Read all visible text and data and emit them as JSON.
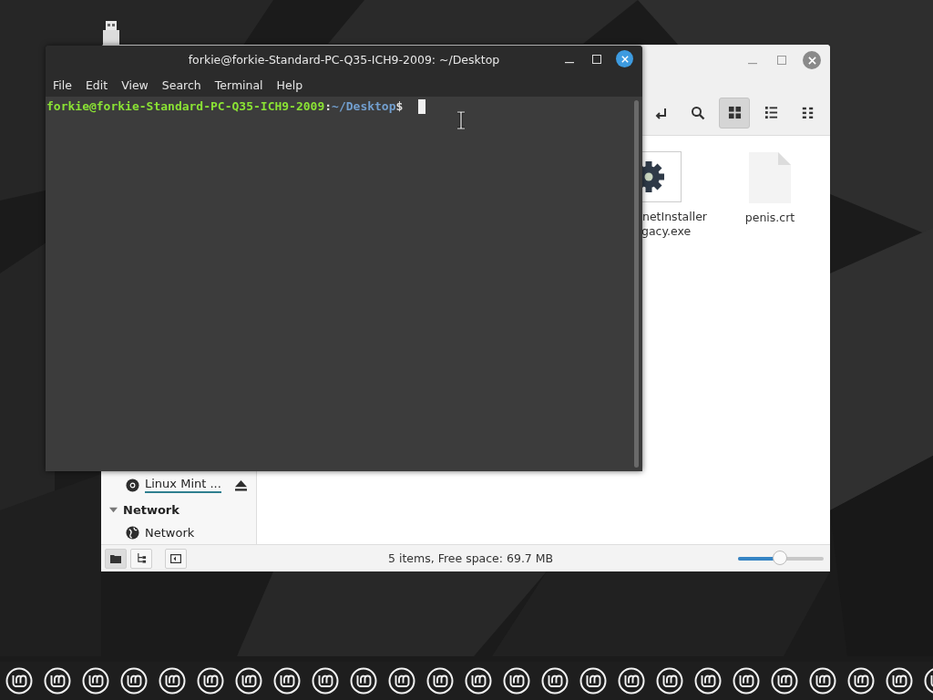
{
  "file_manager": {
    "toolbar": [
      {
        "kind": "location",
        "selected": false
      },
      {
        "kind": "search",
        "selected": false
      },
      {
        "kind": "icon_view",
        "selected": true
      },
      {
        "kind": "list_view",
        "selected": false
      },
      {
        "kind": "compact_view",
        "selected": false
      }
    ],
    "files": [
      {
        "kind": "executable",
        "name_lines": [
          "netInstaller",
          "gacy.exe"
        ]
      },
      {
        "kind": "document",
        "name_lines": [
          "penis.crt"
        ]
      }
    ],
    "sidebar": [
      {
        "kind": "device",
        "label": "Linux Mint ...",
        "level": 1,
        "ejectable": true
      },
      {
        "kind": "header",
        "label": "Network",
        "expanded": true
      },
      {
        "kind": "network",
        "label": "Network"
      }
    ],
    "bottom_buttons": [
      {
        "kind": "places",
        "selected": true
      },
      {
        "kind": "tree",
        "selected": false
      },
      {
        "kind": "sidebar_toggle",
        "selected": false
      }
    ],
    "status": "5 items, Free space: 69.7 MB",
    "zoom": {
      "level": 0.49
    }
  },
  "terminal": {
    "title": "forkie@forkie-Standard-PC-Q35-ICH9-2009: ~/Desktop",
    "menu": [
      "File",
      "Edit",
      "View",
      "Search",
      "Terminal",
      "Help"
    ],
    "prompt": {
      "user_host": "forkie@forkie-Standard-PC-Q35-ICH9-2009",
      "separator": ":",
      "path": "~/Desktop",
      "symbol": "$"
    }
  }
}
